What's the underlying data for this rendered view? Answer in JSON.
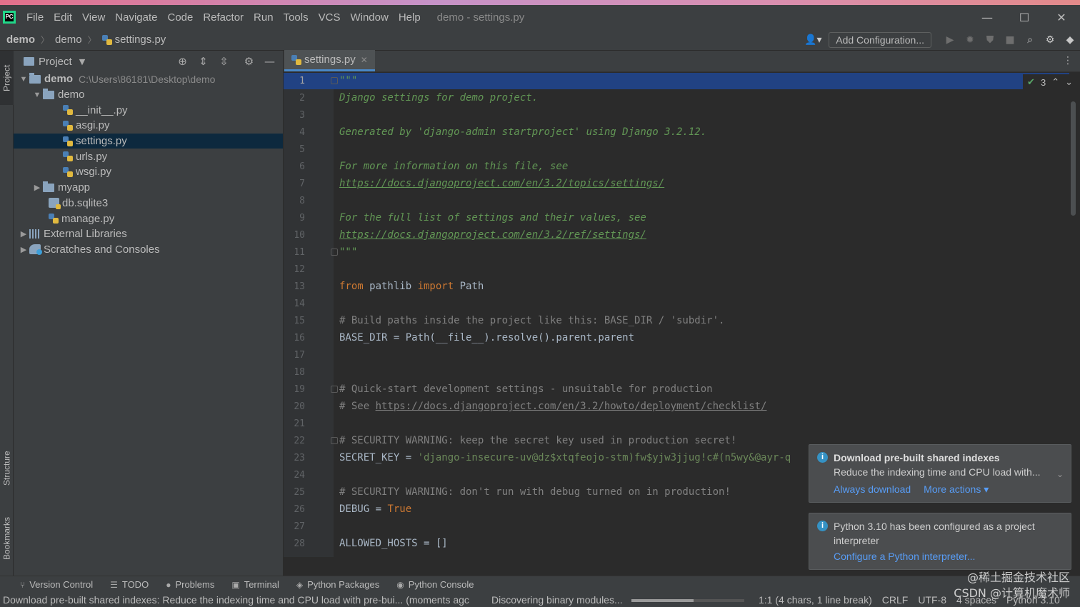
{
  "app": {
    "window_title": "demo - settings.py",
    "menu": [
      "File",
      "Edit",
      "View",
      "Navigate",
      "Code",
      "Refactor",
      "Run",
      "Tools",
      "VCS",
      "Window",
      "Help"
    ]
  },
  "breadcrumb": [
    "demo",
    "demo",
    "settings.py"
  ],
  "toolbar": {
    "add_configuration": "Add Configuration..."
  },
  "project_panel": {
    "title": "Project",
    "tree": [
      {
        "label": "demo",
        "path": "C:\\Users\\86181\\Desktop\\demo"
      },
      {
        "label": "demo"
      },
      {
        "label": "__init__.py"
      },
      {
        "label": "asgi.py"
      },
      {
        "label": "settings.py"
      },
      {
        "label": "urls.py"
      },
      {
        "label": "wsgi.py"
      },
      {
        "label": "myapp"
      },
      {
        "label": "db.sqlite3"
      },
      {
        "label": "manage.py"
      },
      {
        "label": "External Libraries"
      },
      {
        "label": "Scratches and Consoles"
      }
    ]
  },
  "left_stripe": {
    "project": "Project",
    "structure": "Structure",
    "bookmarks": "Bookmarks"
  },
  "editor": {
    "tab_label": "settings.py",
    "inspection_count": "3",
    "lines": [
      "\"\"\"",
      "Django settings for demo project.",
      "",
      "Generated by 'django-admin startproject' using Django 3.2.12.",
      "",
      "For more information on this file, see",
      "https://docs.djangoproject.com/en/3.2/topics/settings/",
      "",
      "For the full list of settings and their values, see",
      "https://docs.djangoproject.com/en/3.2/ref/settings/",
      "\"\"\"",
      "",
      "from pathlib import Path",
      "",
      "# Build paths inside the project like this: BASE_DIR / 'subdir'.",
      "BASE_DIR = Path(__file__).resolve().parent.parent",
      "",
      "",
      "# Quick-start development settings - unsuitable for production",
      "# See https://docs.djangoproject.com/en/3.2/howto/deployment/checklist/",
      "",
      "# SECURITY WARNING: keep the secret key used in production secret!",
      "SECRET_KEY = 'django-insecure-uv@dz$xtqfeojo-stm)fw$yjw3jjug!c#(n5wy&@ayr-q",
      "",
      "# SECURITY WARNING: don't run with debug turned on in production!",
      "DEBUG = True",
      "",
      "ALLOWED_HOSTS = []"
    ],
    "line_numbers": [
      "1",
      "2",
      "3",
      "4",
      "5",
      "6",
      "7",
      "8",
      "9",
      "10",
      "11",
      "12",
      "13",
      "14",
      "15",
      "16",
      "17",
      "18",
      "19",
      "20",
      "21",
      "22",
      "23",
      "24",
      "25",
      "26",
      "27",
      "28"
    ],
    "code_parts": {
      "l13_from": "from",
      "l13_mid": " pathlib ",
      "l13_import": "import",
      "l13_end": " Path",
      "l20_pre": "# See ",
      "l20_link": "https://docs.djangoproject.com/en/3.2/howto/deployment/checklist/",
      "l23_pre": "SECRET_KEY = ",
      "l23_str": "'django-insecure-uv@dz$xtqfeojo-stm)fw$yjw3jjug!c#(n5wy&@ayr-q",
      "l26_pre": "DEBUG = ",
      "l26_true": "True"
    }
  },
  "notifications": [
    {
      "title": "Download pre-built shared indexes",
      "body": "Reduce the indexing time and CPU load with...",
      "actions": [
        "Always download",
        "More actions ▾"
      ]
    },
    {
      "body": "Python 3.10 has been configured as a project interpreter",
      "actions": [
        "Configure a Python interpreter..."
      ]
    }
  ],
  "tool_windows": [
    "Version Control",
    "TODO",
    "Problems",
    "Terminal",
    "Python Packages",
    "Python Console"
  ],
  "status": {
    "message": "Download pre-built shared indexes: Reduce the indexing time and CPU load with pre-bui... (moments agc",
    "progress_text": "Discovering binary modules...",
    "progress": 0.55,
    "caret": "1:1 (4 chars, 1 line break)",
    "line_sep": "CRLF",
    "encoding": "UTF-8",
    "indent": "4 spaces",
    "interpreter": "Python 3.10"
  },
  "watermark": [
    "@稀土掘金技术社区",
    "CSDN @计算机魔术师"
  ],
  "colors": {
    "accent": "#4a88c7",
    "selection": "#0d293e",
    "current_line": "#214283",
    "link": "#589df6"
  }
}
